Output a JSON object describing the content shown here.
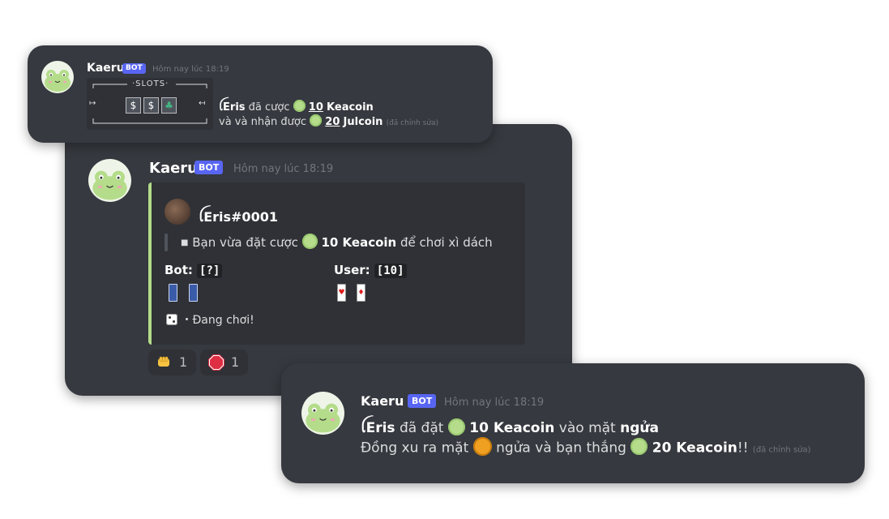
{
  "message1": {
    "username": "Kaeru",
    "badge": "BOT",
    "timestamp": "Hôm nay lúc 18:19",
    "slots_title": "·SLOTS·",
    "slots_left_arrow": "↦",
    "slots_right_arrow": "↤",
    "slot_icons": [
      "money-bag",
      "money-bag",
      "four-leaf-clover"
    ],
    "line1_user": "ꪶEris",
    "line1_text": "đã cược",
    "line1_amount": "10",
    "line1_currency": "Keacoin",
    "line2_text": "và và nhận được",
    "line2_amount": "20",
    "line2_currency": "Julcoin",
    "edited": "(đã chỉnh sửa)"
  },
  "message2": {
    "username": "Kaeru",
    "badge": "BOT",
    "timestamp": "Hôm nay lúc 18:19",
    "embed": {
      "author": "ꪶEris#0001",
      "desc_prefix": "Bạn vừa đặt cược",
      "desc_amount": "10 Keacoin",
      "desc_suffix": "để chơi xì dách",
      "bot_label": "Bot:",
      "bot_value": "[?]",
      "user_label": "User:",
      "user_value": "[10]",
      "user_cards": [
        "♥",
        "♦"
      ],
      "status": "・Đang chơi!"
    },
    "reactions": [
      {
        "icon": "fist-bump-icon",
        "count": "1"
      },
      {
        "icon": "stop-sign-icon",
        "count": "1"
      }
    ]
  },
  "message3": {
    "username": "Kaeru",
    "badge": "BOT",
    "timestamp": "Hôm nay lúc 18:19",
    "line1_user": "ꪶEris",
    "line1_text": "đã đặt",
    "line1_amount": "10 Keacoin",
    "line1_mid": "vào mặt",
    "line1_side": "ngửa",
    "line2_prefix": "Đồng xu ra mặt",
    "line2_mid": "ngửa và bạn thắng",
    "line2_amount": "20 Keacoin",
    "line2_suffix": "!!",
    "edited": "(đã chỉnh sửa)"
  },
  "colors": {
    "background": "#36393f",
    "embed_bg": "#2f3136",
    "embed_accent": "#b4dc8a",
    "bot_badge": "#5865f2",
    "timestamp": "#72767d"
  }
}
